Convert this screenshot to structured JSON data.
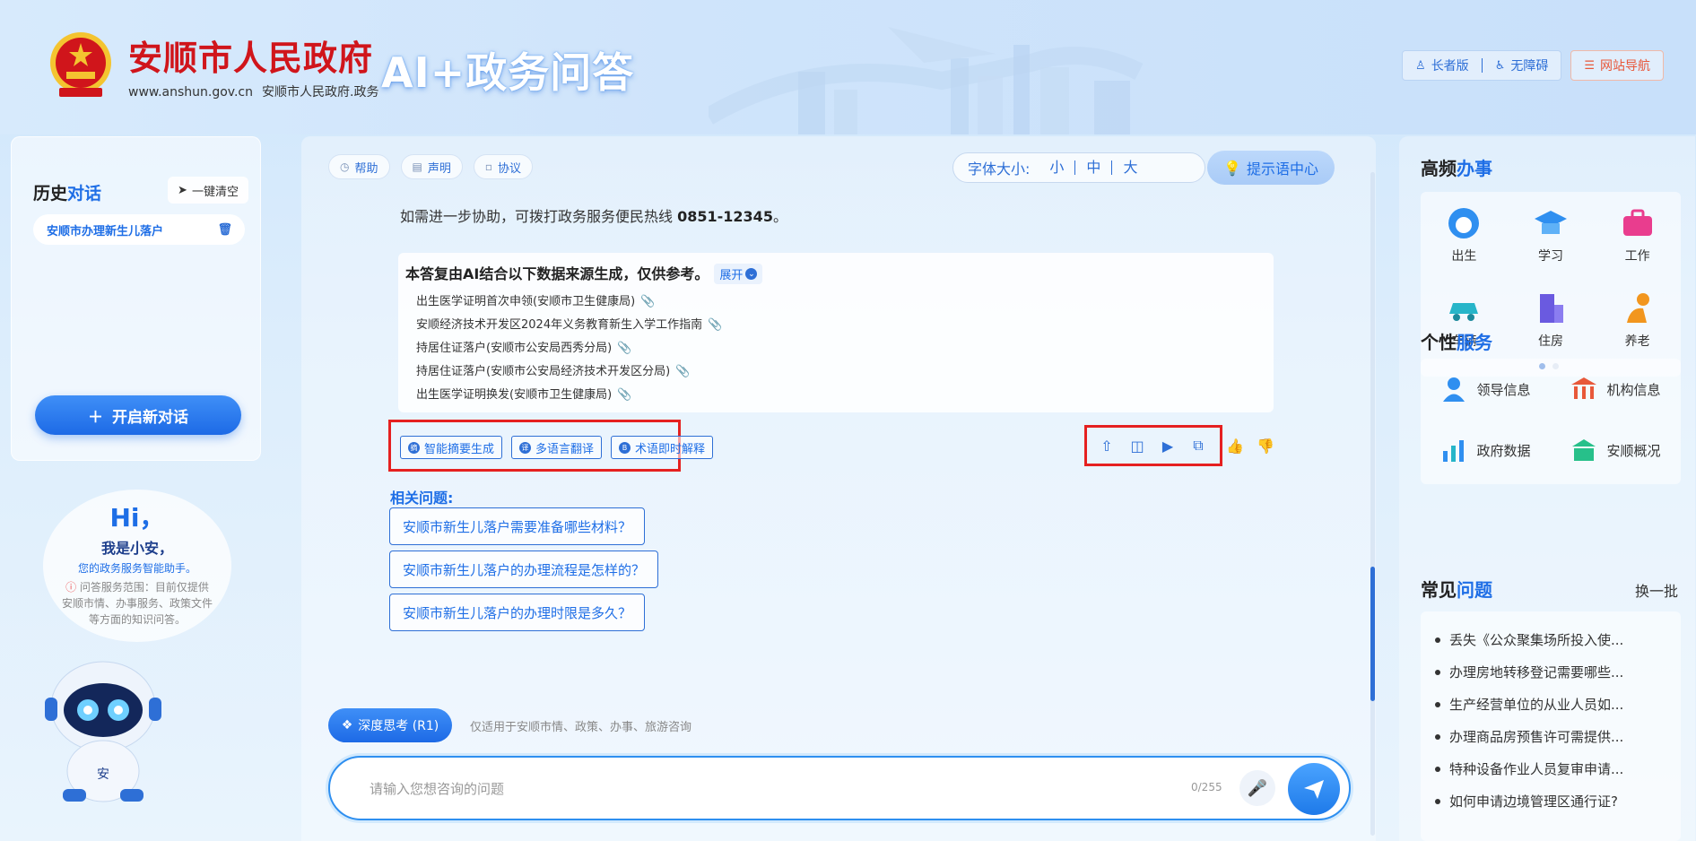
{
  "header": {
    "gov_title": "安顺市人民政府",
    "gov_url": "www.anshun.gov.cn",
    "gov_sub": "安顺市人民政府.政务",
    "ai_title": "AI+政务问答",
    "elder_label": "长者版",
    "access_label": "无障碍",
    "nav_label": "网站导航"
  },
  "sidebar": {
    "history_title_a": "历史",
    "history_title_b": "对话",
    "clear_label": "一键清空",
    "history_items": [
      "安顺市办理新生儿落户"
    ],
    "new_chat_label": "开启新对话"
  },
  "assistant": {
    "hi": "Hi，",
    "name": "我是小安，",
    "subtitle": "您的政务服务智能助手。",
    "note": "问答服务范围：目前仅提供安顺市情、办事服务、政策文件等方面的知识问答。",
    "badge": "安"
  },
  "toolbar": {
    "help_label": "帮助",
    "statement_label": "声明",
    "agreement_label": "协议",
    "font_size_label": "字体大小:",
    "font_small": "小",
    "font_medium": "中",
    "font_large": "大",
    "tips_label": "提示语中心"
  },
  "answer": {
    "hotline_text": "如需进一步协助，可拨打政务服务便民热线",
    "hotline_number": "0851-12345",
    "hotline_end": "。",
    "source_title": "本答复由AI结合以下数据来源生成，仅供参考。",
    "expand_label": "展开",
    "sources": [
      "出生医学证明首次申领(安顺市卫生健康局)",
      "安顺经济技术开发区2024年义务教育新生入学工作指南",
      "持居住证落户(安顺市公安局西秀分局)",
      "持居住证落户(安顺市公安局经济技术开发区分局)",
      "出生医学证明换发(安顺市卫生健康局)"
    ],
    "tools": [
      {
        "label": "智能摘要生成",
        "icon": "摘"
      },
      {
        "label": "多语言翻译",
        "icon": "译"
      },
      {
        "label": "术语即时解释",
        "icon": "B"
      }
    ]
  },
  "related": {
    "title": "相关问题:",
    "questions": [
      "安顺市新生儿落户需要准备哪些材料？",
      "安顺市新生儿落户的办理流程是怎样的？",
      "安顺市新生儿落户的办理时限是多久？"
    ]
  },
  "composer": {
    "deep_label": "深度思考 (R1)",
    "hint": "仅适用于安顺市情、政策、办事、旅游咨询",
    "placeholder": "请输入您想咨询的问题",
    "counter": "0/255"
  },
  "right": {
    "freq_title_a": "高频",
    "freq_title_b": "办事",
    "services": [
      {
        "label": "出生",
        "icon": "baby-icon",
        "color": "#2f8ff0"
      },
      {
        "label": "学习",
        "icon": "graduation-cap-icon",
        "color": "#2f8ff0"
      },
      {
        "label": "工作",
        "icon": "briefcase-icon",
        "color": "#e93d8e"
      },
      {
        "label": "车辆",
        "icon": "car-icon",
        "color": "#27b5c9"
      },
      {
        "label": "住房",
        "icon": "building-icon",
        "color": "#6a5ae0"
      },
      {
        "label": "养老",
        "icon": "elder-icon",
        "color": "#f2961e"
      }
    ],
    "personal_title_a": "个性",
    "personal_title_b": "服务",
    "personal": [
      {
        "label": "领导信息",
        "icon": "person-icon"
      },
      {
        "label": "机构信息",
        "icon": "institution-icon"
      },
      {
        "label": "政府数据",
        "icon": "data-chart-icon"
      },
      {
        "label": "安顺概况",
        "icon": "overview-icon"
      }
    ],
    "faq_title_a": "常见",
    "faq_title_b": "问题",
    "swap_label": "换一批",
    "faq": [
      "丢失《公众聚集场所投入使...",
      "办理房地转移登记需要哪些...",
      "生产经营单位的从业人员如...",
      "办理商品房预售许可需提供...",
      "特种设备作业人员复审申请...",
      "如何申请边境管理区通行证?"
    ]
  }
}
